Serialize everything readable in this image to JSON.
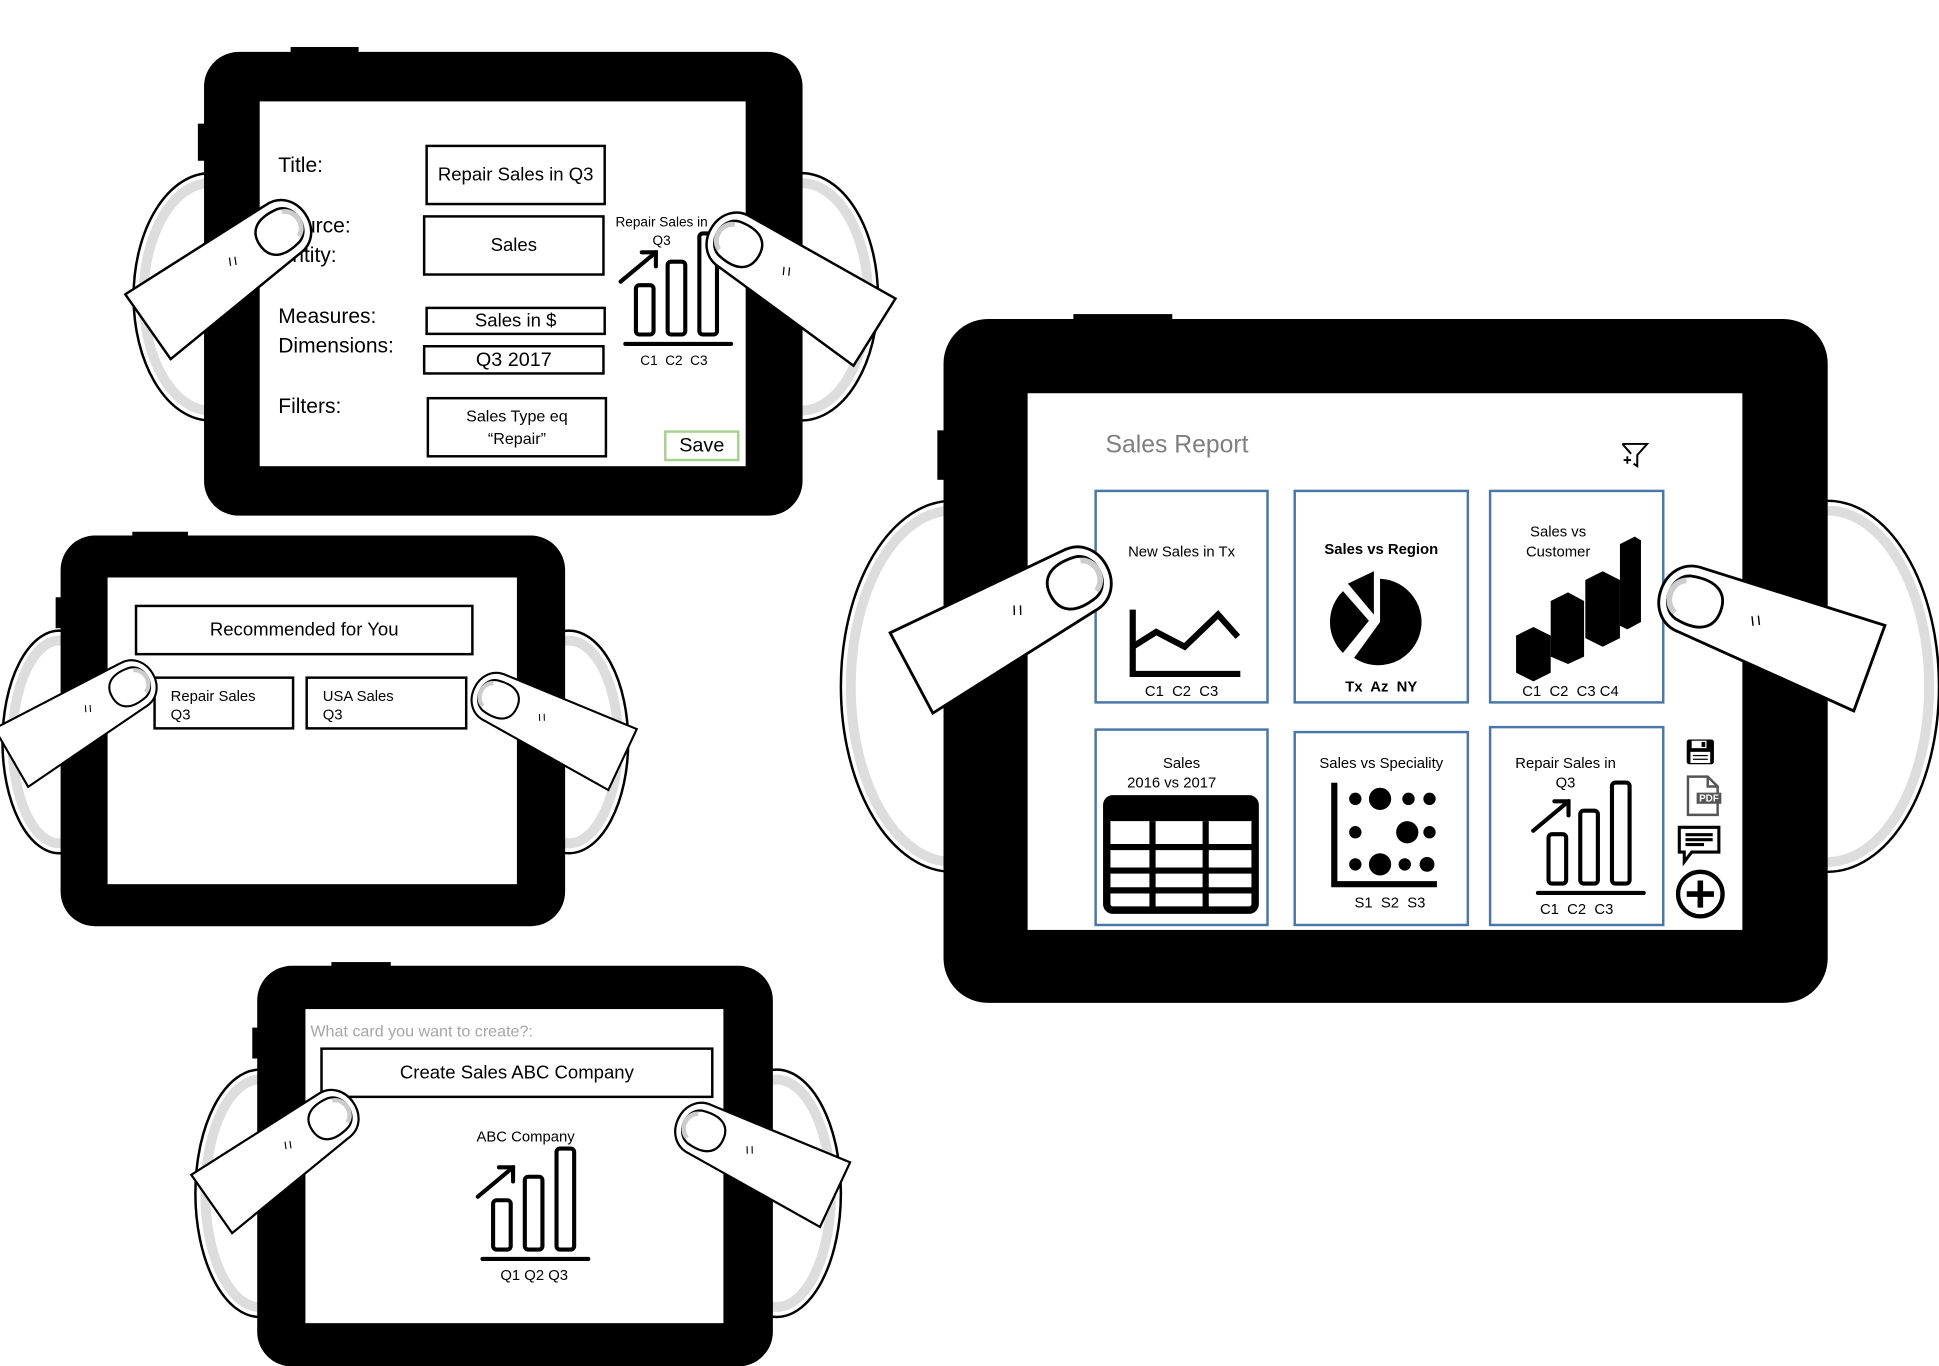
{
  "editor": {
    "title_label": "Title:",
    "title_value": "Repair Sales in Q3",
    "source_label_1": "Source:",
    "source_label_2": "Entity:",
    "source_value": "Sales",
    "measures_label": "Measures:",
    "measures_value": "Sales in $",
    "dimensions_label": "Dimensions:",
    "dimensions_value": "Q3 2017",
    "filters_label": "Filters:",
    "filters_value_1": "Sales Type eq",
    "filters_value_2": "“Repair”",
    "save_label": "Save",
    "preview": {
      "title_1": "Repair Sales in",
      "title_2": "Q3",
      "axis": "C1  C2  C3"
    }
  },
  "recommend": {
    "header": "Recommended for You",
    "cards": [
      {
        "line1": "Repair Sales",
        "line2": "Q3"
      },
      {
        "line1": "USA Sales",
        "line2": "Q3"
      }
    ]
  },
  "create": {
    "prompt": "What card you want to create?:",
    "input_value": "Create Sales ABC Company",
    "preview": {
      "title": "ABC Company",
      "axis": "Q1 Q2 Q3"
    }
  },
  "report": {
    "title": "Sales Report",
    "cards": [
      {
        "title": "New Sales in Tx",
        "axis": "C1  C2  C3",
        "icon": "line-chart-icon"
      },
      {
        "title": "Sales vs Region",
        "axis": "Tx  Az  NY",
        "icon": "pie-chart-icon"
      },
      {
        "title_1": "Sales vs",
        "title_2": "Customer",
        "axis": "C1  C2  C3 C4",
        "icon": "3d-bar-chart-icon"
      },
      {
        "title_1": "Sales",
        "title_2": "2016 vs 2017",
        "icon": "table-icon"
      },
      {
        "title": "Sales vs Speciality",
        "axis": "S1  S2  S3",
        "icon": "scatter-chart-icon"
      },
      {
        "title_1": "Repair Sales in",
        "title_2": "Q3",
        "axis": "C1  C2  C3",
        "icon": "bar-chart-icon"
      }
    ],
    "actions": [
      "save-icon",
      "pdf-icon",
      "comment-icon",
      "add-icon"
    ],
    "pdf_badge": "PDF"
  },
  "colors": {
    "card_border": "#4a76a8",
    "save_border": "#a9d18e",
    "title_grey": "#7f7f7f"
  }
}
